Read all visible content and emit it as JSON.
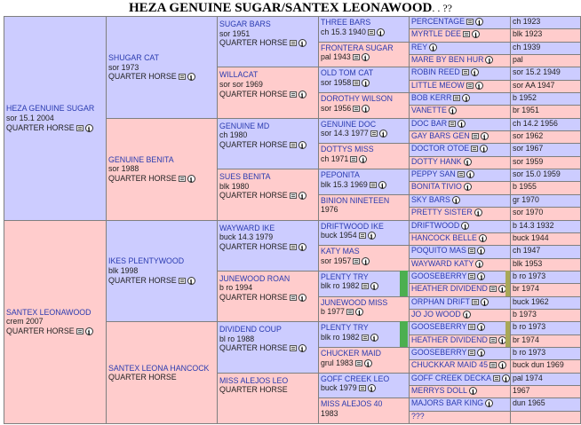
{
  "title": "HEZA GENUINE SUGAR/SANTEX LEONAWOOD",
  "title_suffix": ". . ??",
  "gen1": [
    {
      "name": "HEZA GENUINE SUGAR",
      "info": "sor 15.1 2004",
      "breed": "QUARTER HORSE"
    },
    {
      "name": "SANTEX LEONAWOOD",
      "info": "crem 2007",
      "breed": "QUARTER HORSE"
    }
  ],
  "gen2": [
    {
      "name": "SHUGAR CAT",
      "info": "sor 1973",
      "breed": "QUARTER HORSE"
    },
    {
      "name": "GENUINE BENITA",
      "info": "sor 1988",
      "breed": "QUARTER HORSE"
    },
    {
      "name": "IKES PLENTYWOOD",
      "info": "blk 1998",
      "breed": "QUARTER HORSE"
    },
    {
      "name": "SANTEX LEONA HANCOCK",
      "info": "",
      "breed": "QUARTER HORSE"
    }
  ],
  "gen3": [
    {
      "name": "SUGAR BARS",
      "info": "sor 1951",
      "breed": "QUARTER HORSE"
    },
    {
      "name": "WILLACAT",
      "info": "sor sor 1969",
      "breed": "QUARTER HORSE"
    },
    {
      "name": "GENUINE MD",
      "info": "ch 1980",
      "breed": "QUARTER HORSE"
    },
    {
      "name": "SUES BENITA",
      "info": "blk 1980",
      "breed": "QUARTER HORSE"
    },
    {
      "name": "WAYWARD IKE",
      "info": "buck 14.3 1979",
      "breed": "QUARTER HORSE"
    },
    {
      "name": "JUNEWOOD ROAN",
      "info": "b ro 1994",
      "breed": "QUARTER HORSE"
    },
    {
      "name": "DIVIDEND COUP",
      "info": "bl ro 1988",
      "breed": "QUARTER HORSE"
    },
    {
      "name": "MISS ALEJOS LEO",
      "info": "",
      "breed": "QUARTER HORSE"
    }
  ],
  "gen4": [
    {
      "name": "THREE BARS",
      "info": "ch 15.3 1940"
    },
    {
      "name": "FRONTERA SUGAR",
      "info": "pal 1943"
    },
    {
      "name": "OLD TOM CAT",
      "info": "sor 1958"
    },
    {
      "name": "DOROTHY WILSON",
      "info": "sor 1956"
    },
    {
      "name": "GENUINE DOC",
      "info": "sor 14.3 1977"
    },
    {
      "name": "DOTTYS MISS",
      "info": "ch 1971"
    },
    {
      "name": "PEPONITA",
      "info": "blk 15.3 1969"
    },
    {
      "name": "BINION NINETEEN",
      "info": "1976"
    },
    {
      "name": "DRIFTWOOD IKE",
      "info": "buck 1954"
    },
    {
      "name": "KATY MAS",
      "info": "sor 1957"
    },
    {
      "name": "PLENTY TRY",
      "info": "blk ro 1982"
    },
    {
      "name": "JUNEWOOD MISS",
      "info": "b 1977"
    },
    {
      "name": "PLENTY TRY",
      "info": "blk ro 1982"
    },
    {
      "name": "CHUCKER MAID",
      "info": "grul 1983"
    },
    {
      "name": "GOFF CREEK LEO",
      "info": "buck 1979"
    },
    {
      "name": "MISS ALEJOS 40",
      "info": "1983"
    }
  ],
  "gen5": [
    {
      "name": "PERCENTAGE",
      "info": "ch 1923"
    },
    {
      "name": "MYRTLE DEE",
      "info": "blk 1923"
    },
    {
      "name": "REY",
      "info": "ch 1939"
    },
    {
      "name": "MARE BY BEN HUR",
      "info": "pal"
    },
    {
      "name": "ROBIN REED",
      "info": "sor 15.2 1949"
    },
    {
      "name": "LITTLE MEOW",
      "info": "sor AA 1947"
    },
    {
      "name": "BOB KERR",
      "info": "b 1952"
    },
    {
      "name": "VANETTE",
      "info": "br 1951"
    },
    {
      "name": "DOC BAR",
      "info": "ch 14.2 1956"
    },
    {
      "name": "GAY BARS GEN",
      "info": "sor 1962"
    },
    {
      "name": "DOCTOR OTOE",
      "info": "sor 1967"
    },
    {
      "name": "DOTTY HANK",
      "info": "sor 1959"
    },
    {
      "name": "PEPPY SAN",
      "info": "sor 15.0 1959"
    },
    {
      "name": "BONITA TIVIO",
      "info": "b 1955"
    },
    {
      "name": "SKY BARS",
      "info": "gr 1970"
    },
    {
      "name": "PRETTY SISTER",
      "info": "sor 1970"
    },
    {
      "name": "DRIFTWOOD",
      "info": "b 14.3 1932"
    },
    {
      "name": "HANCOCK BELLE",
      "info": "buck 1944"
    },
    {
      "name": "POQUITO MAS",
      "info": "ch 1947"
    },
    {
      "name": "WAYWARD KATY",
      "info": "blk 1953"
    },
    {
      "name": "GOOSEBERRY",
      "info": "b ro 1973"
    },
    {
      "name": "HEATHER DIVIDEND",
      "info": "br 1974"
    },
    {
      "name": "ORPHAN DRIFT",
      "info": "buck 1962"
    },
    {
      "name": "JO JO WOOD",
      "info": "b 1973"
    },
    {
      "name": "GOOSEBERRY",
      "info": "b ro 1973"
    },
    {
      "name": "HEATHER DIVIDEND",
      "info": "br 1974"
    },
    {
      "name": "GOOSEBERRY",
      "info": "b ro 1973"
    },
    {
      "name": "CHUCKKAR MAID 45",
      "info": "buck dun 1969"
    },
    {
      "name": "GOFF CREEK DECKA",
      "info": "pal 1974"
    },
    {
      "name": "MERRYS DOLL",
      "info": "1967"
    },
    {
      "name": "MAJORS BAR KING",
      "info": "dun 1965"
    },
    {
      "name": "???",
      "info": ""
    }
  ],
  "colors": {
    "sire_bg": "#ccccff",
    "dam_bg": "#ffcccc",
    "link": "#2a3bb0",
    "link_dam": "#c21a8c",
    "border": "#7f7f7f"
  },
  "icons": {
    "document": "document-icon",
    "info": "info-icon"
  }
}
